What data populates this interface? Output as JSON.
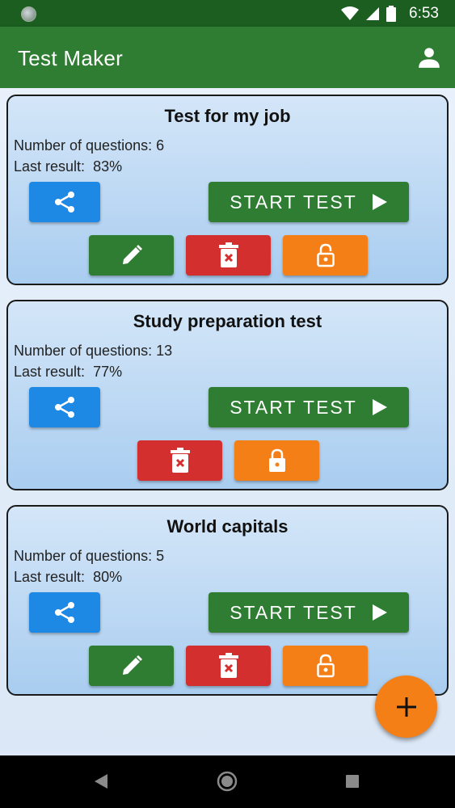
{
  "status_bar": {
    "time": "6:53",
    "icons": [
      "wifi-icon",
      "signal-icon",
      "battery-icon"
    ]
  },
  "app_bar": {
    "title": "Test Maker",
    "profile_icon": "person-icon"
  },
  "labels": {
    "questions_prefix": "Number of questions:",
    "result_prefix": "Last result:",
    "start_button": "START TEST"
  },
  "tests": [
    {
      "title": "Test for my job",
      "questions": "6",
      "last_result": "83%",
      "editable": true,
      "locked": false
    },
    {
      "title": "Study preparation test",
      "questions": "13",
      "last_result": "77%",
      "editable": false,
      "locked": true
    },
    {
      "title": "World capitals",
      "questions": "5",
      "last_result": "80%",
      "editable": true,
      "locked": false
    }
  ],
  "colors": {
    "app_bar": "#2e7d32",
    "status_bar": "#1b5e20",
    "share": "#1e88e5",
    "start": "#2e7d32",
    "edit": "#2e7d32",
    "delete": "#d32f2f",
    "lock": "#f57f17",
    "fab": "#f57f17"
  },
  "fab": {
    "icon": "plus-icon"
  },
  "nav_bar": {
    "icons": [
      "back-icon",
      "home-icon",
      "recents-icon"
    ]
  }
}
